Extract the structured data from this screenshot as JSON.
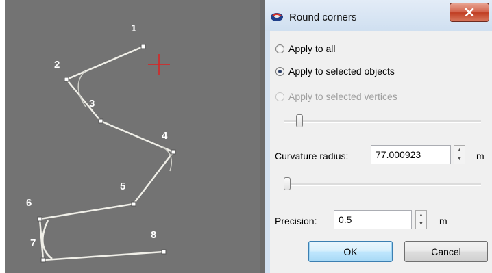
{
  "canvas": {
    "background_color": "#737373",
    "line_color": "#f0efe8",
    "vertex_labels": [
      "1",
      "2",
      "3",
      "4",
      "5",
      "6",
      "7",
      "8"
    ],
    "cursor_color": "#e02020"
  },
  "dialog": {
    "title": "Round corners",
    "title_icon": "app-globe-icon",
    "close_icon": "close-x-icon",
    "options": [
      {
        "label": "Apply to all",
        "checked": false,
        "enabled": true
      },
      {
        "label": "Apply to selected objects",
        "checked": true,
        "enabled": true
      },
      {
        "label": "Apply to selected vertices",
        "checked": false,
        "enabled": false
      }
    ],
    "curvature_radius": {
      "label": "Curvature radius:",
      "value": "77.000923",
      "unit": "m"
    },
    "precision": {
      "label": "Precision:",
      "value": "0.5",
      "unit": "m"
    },
    "buttons": {
      "ok": "OK",
      "cancel": "Cancel"
    },
    "accent_color": "#3c7fb1"
  }
}
